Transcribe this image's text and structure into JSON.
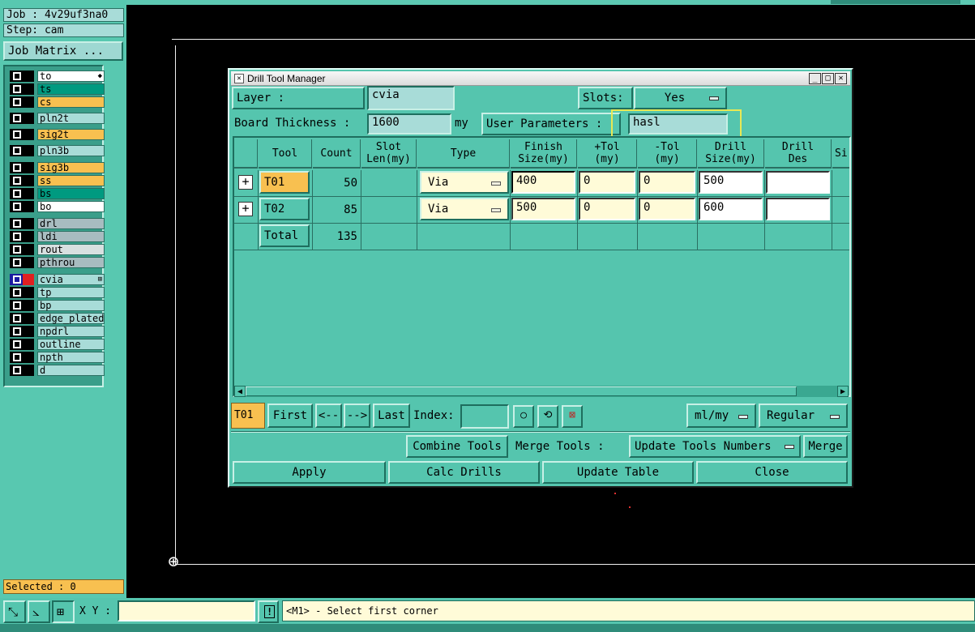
{
  "job": {
    "job_label": "Job : 4v29uf3na0",
    "step_label": "Step: cam",
    "matrix_button": "Job Matrix ..."
  },
  "layers": [
    {
      "name": "to",
      "color": "#ffffff",
      "marker": "◆"
    },
    {
      "name": "ts",
      "color": "#009a80"
    },
    {
      "name": "cs",
      "color": "#f8c050"
    },
    {
      "name": "pln2t",
      "color": "#a8dcd8"
    },
    {
      "name": "sig2t",
      "color": "#f8c050"
    },
    {
      "name": "pln3b",
      "color": "#a8dcd8"
    },
    {
      "name": "sig3b",
      "color": "#f8c050"
    },
    {
      "name": "ss",
      "color": "#f8c050"
    },
    {
      "name": "bs",
      "color": "#009a80"
    },
    {
      "name": "bo",
      "color": "#ffffff"
    },
    {
      "name": "drl",
      "color": "#a8bcc0"
    },
    {
      "name": "ldi",
      "color": "#a8bcc0"
    },
    {
      "name": "rout",
      "color": "#d8e0e0"
    },
    {
      "name": "pthrou",
      "color": "#a8bcc0"
    },
    {
      "name": "cvia",
      "color": "#a8dcd8",
      "marker": "⊞"
    },
    {
      "name": "tp",
      "color": "#a8dcd8"
    },
    {
      "name": "bp",
      "color": "#a8dcd8"
    },
    {
      "name": "edge_plated",
      "color": "#a8dcd8"
    },
    {
      "name": "npdrl",
      "color": "#a8dcd8"
    },
    {
      "name": "outline",
      "color": "#a8dcd8"
    },
    {
      "name": "npth",
      "color": "#a8dcd8"
    },
    {
      "name": "d",
      "color": "#a8dcd8"
    }
  ],
  "selected": "Selected : 0",
  "bottom": {
    "xy_label": "X Y :",
    "xy_value": "",
    "info_icon": "!",
    "status": "<M1> - Select first corner"
  },
  "dialog": {
    "title": "Drill Tool Manager",
    "layer_label": "Layer          :",
    "layer_value": "cvia",
    "slots_label": "Slots:",
    "slots_value": "Yes",
    "board_thickness_label": "Board Thickness :",
    "board_thickness_value": "1600",
    "board_thickness_unit": "my",
    "user_params_label": "User Parameters :",
    "user_params_value": "hasl",
    "columns": [
      "Tool",
      "Count",
      "Slot\nLen(my)",
      "Type",
      "Finish\nSize(my)",
      "+Tol\n(my)",
      "-Tol\n(my)",
      "Drill\nSize(my)",
      "Drill\nDes",
      "Si"
    ],
    "rows": [
      {
        "tool": "T01",
        "count": "50",
        "slot_len": "",
        "type": "Via",
        "finish": "400",
        "ptol": "0",
        "mtol": "0",
        "drill": "500",
        "des": ""
      },
      {
        "tool": "T02",
        "count": "85",
        "slot_len": "",
        "type": "Via",
        "finish": "500",
        "ptol": "0",
        "mtol": "0",
        "drill": "600",
        "des": ""
      }
    ],
    "total_label": "Total",
    "total_count": "135",
    "current_tool": "T01",
    "nav": {
      "first": "First",
      "prev": "<--",
      "next": "-->",
      "last": "Last",
      "index_label": "Index:",
      "index_value": "",
      "units": "ml/my",
      "mode": "Regular"
    },
    "actions": {
      "combine": "Combine Tools",
      "merge_label": "Merge Tools :",
      "merge_option": "Update Tools Numbers",
      "merge": "Merge",
      "apply": "Apply",
      "calc": "Calc Drills",
      "update": "Update Table",
      "close": "Close"
    }
  },
  "colors": {
    "panel": "#55c5ae",
    "field": "#a8dcd8",
    "input": "#fffbd8",
    "orange": "#f8c050",
    "highlight": "#e8e854"
  }
}
